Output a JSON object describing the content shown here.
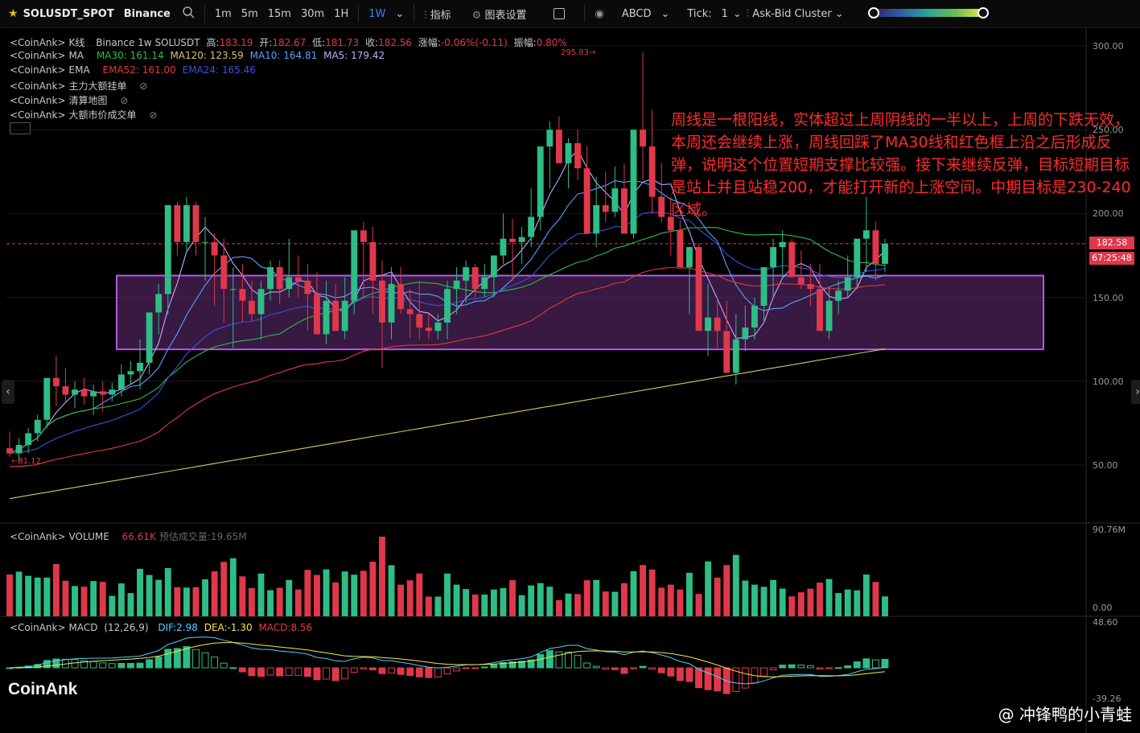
{
  "toolbar": {
    "symbol": "SOLUSDT_SPOT",
    "exchange": "Binance",
    "intervals": [
      "1m",
      "5m",
      "15m",
      "30m",
      "1H",
      "1W"
    ],
    "active_interval": "1W",
    "indicators_label": "指标",
    "chart_settings_label": "图表设置",
    "abcd_label": "ABCD",
    "tick_label": "Tick:",
    "tick_value": "1",
    "cluster_label": "Ask-Bid Cluster"
  },
  "legends": {
    "kline": {
      "source": "<CoinAnk>",
      "name": "K线",
      "info": "Binance 1w SOLUSDT",
      "high_label": "高:",
      "high": "183.19",
      "open_label": "开:",
      "open": "182.67",
      "low_label": "低:",
      "low": "181.73",
      "close_label": "收:",
      "close": "182.56",
      "change_label": "涨幅:",
      "change": "-0.06%(-0.11)",
      "amp_label": "振幅:",
      "amp": "0.80%"
    },
    "ma": {
      "source": "<CoinAnk>",
      "name": "MA",
      "ma30": "MA30: 161.14",
      "ma120": "MA120: 123.59",
      "ma10": "MA10: 164.81",
      "ma5": "MA5: 179.42"
    },
    "ema": {
      "source": "<CoinAnk>",
      "name": "EMA",
      "ema52": "EMA52: 161.00",
      "ema24": "EMA24: 165.46"
    },
    "big_orders": {
      "source": "<CoinAnk>",
      "name": "主力大额挂单"
    },
    "liq_map": {
      "source": "<CoinAnk>",
      "name": "清算地图"
    },
    "big_trades": {
      "source": "<CoinAnk>",
      "name": "大额市价成交单"
    },
    "volume": {
      "source": "<CoinAnk>",
      "name": "VOLUME",
      "vol": "66.61K",
      "est_label": "预估成交量:",
      "est": "19.65M"
    },
    "macd": {
      "source": "<CoinAnk>",
      "name": "MACD",
      "params": "(12,26,9)",
      "dif": "DIF:2.98",
      "dea": "DEA:-1.30",
      "macd": "MACD:8.56"
    }
  },
  "annotation": {
    "text": "周线是一根阳线，实体超过上周阴线的一半以上，上周的下跌无效，本周还会继续上涨，周线回踩了MA30线和红色框上沿之后形成反弹，说明这个位置短期支撑比较强。接下来继续反弹，目标短期目标是站上并且站稳200，才能打开新的上涨空间。中期目标是230-240区域。"
  },
  "price_axis": {
    "labels": [
      "300.00",
      "250.00",
      "200.00",
      "150.00",
      "100.00",
      "50.00"
    ],
    "current_price": "182.58",
    "countdown": "67:25:48",
    "high_marker": "295.83",
    "low_marker": "81.12"
  },
  "volume_axis": {
    "top": "90.76M",
    "bottom": "0.00"
  },
  "macd_axis": {
    "top": "48.60",
    "bottom": "-39.26"
  },
  "branding": {
    "logo": "CoinAnk",
    "watermark": "@ 冲锋鸭的小青蛙"
  },
  "colors": {
    "up": "#2ebd85",
    "down": "#e0384b",
    "box_fill": "#5b2a6e",
    "box_border": "#b45ae0",
    "annotation": "#ff2a2a",
    "ma5": "#c6a7ff",
    "ma10": "#5aa0ff",
    "ma30": "#2ebd4a",
    "ma120": "#d8c46a",
    "ema52": "#e03b3b",
    "ema24": "#3a52e0"
  },
  "chart_data": {
    "type": "candlestick",
    "title": "SOLUSDT 1w",
    "ylim": [
      0,
      310
    ],
    "y_ticks": [
      50,
      100,
      150,
      200,
      250,
      300
    ],
    "support_box": {
      "low": 119,
      "high": 163
    },
    "candles": [
      [
        60,
        70,
        55,
        57
      ],
      [
        57,
        66,
        51,
        62
      ],
      [
        62,
        72,
        57,
        69
      ],
      [
        69,
        80,
        64,
        77
      ],
      [
        77,
        90,
        72,
        102
      ],
      [
        102,
        115,
        85,
        97
      ],
      [
        97,
        108,
        88,
        92
      ],
      [
        92,
        100,
        84,
        95
      ],
      [
        95,
        102,
        86,
        91
      ],
      [
        91,
        98,
        80,
        94
      ],
      [
        94,
        100,
        82,
        92
      ],
      [
        92,
        99,
        88,
        95
      ],
      [
        95,
        110,
        91,
        104
      ],
      [
        104,
        112,
        98,
        106
      ],
      [
        106,
        125,
        95,
        111
      ],
      [
        111,
        132,
        104,
        141
      ],
      [
        141,
        158,
        128,
        152
      ],
      [
        152,
        185,
        140,
        205
      ],
      [
        205,
        207,
        175,
        183
      ],
      [
        183,
        210,
        178,
        205
      ],
      [
        205,
        207,
        175,
        183
      ],
      [
        183,
        198,
        160,
        183
      ],
      [
        183,
        188,
        145,
        175
      ],
      [
        175,
        185,
        135,
        155
      ],
      [
        155,
        168,
        120,
        155
      ],
      [
        155,
        170,
        135,
        148
      ],
      [
        148,
        160,
        136,
        140
      ],
      [
        140,
        160,
        125,
        155
      ],
      [
        155,
        172,
        148,
        168
      ],
      [
        168,
        172,
        146,
        155
      ],
      [
        155,
        185,
        150,
        162
      ],
      [
        162,
        175,
        150,
        160
      ],
      [
        160,
        170,
        130,
        152
      ],
      [
        152,
        165,
        130,
        128
      ],
      [
        128,
        160,
        122,
        148
      ],
      [
        148,
        158,
        130,
        130
      ],
      [
        130,
        162,
        125,
        148
      ],
      [
        148,
        178,
        140,
        190
      ],
      [
        190,
        195,
        150,
        183
      ],
      [
        183,
        192,
        140,
        160
      ],
      [
        160,
        172,
        108,
        135
      ],
      [
        135,
        168,
        125,
        158
      ],
      [
        158,
        168,
        140,
        143
      ],
      [
        143,
        155,
        126,
        140
      ],
      [
        140,
        160,
        125,
        132
      ],
      [
        132,
        140,
        125,
        130
      ],
      [
        130,
        140,
        125,
        135
      ],
      [
        135,
        160,
        125,
        155
      ],
      [
        155,
        168,
        140,
        160
      ],
      [
        160,
        172,
        147,
        168
      ],
      [
        168,
        170,
        150,
        155
      ],
      [
        155,
        170,
        150,
        162
      ],
      [
        162,
        175,
        150,
        175
      ],
      [
        175,
        200,
        170,
        185
      ],
      [
        185,
        197,
        160,
        183
      ],
      [
        183,
        192,
        170,
        186
      ],
      [
        186,
        215,
        180,
        198
      ],
      [
        198,
        230,
        190,
        240
      ],
      [
        240,
        255,
        215,
        250
      ],
      [
        250,
        258,
        235,
        230
      ],
      [
        230,
        245,
        215,
        242
      ],
      [
        242,
        250,
        220,
        227
      ],
      [
        227,
        240,
        195,
        188
      ],
      [
        188,
        222,
        180,
        205
      ],
      [
        205,
        225,
        195,
        201
      ],
      [
        201,
        228,
        198,
        215
      ],
      [
        215,
        230,
        190,
        188
      ],
      [
        188,
        240,
        185,
        250
      ],
      [
        250,
        296,
        220,
        240
      ],
      [
        240,
        262,
        200,
        210
      ],
      [
        210,
        230,
        195,
        198
      ],
      [
        198,
        210,
        175,
        190
      ],
      [
        190,
        196,
        168,
        168
      ],
      [
        168,
        180,
        140,
        180
      ],
      [
        180,
        182,
        160,
        130
      ],
      [
        130,
        158,
        115,
        138
      ],
      [
        138,
        150,
        120,
        130
      ],
      [
        130,
        148,
        110,
        105
      ],
      [
        105,
        140,
        98,
        125
      ],
      [
        125,
        145,
        118,
        132
      ],
      [
        132,
        150,
        125,
        145
      ],
      [
        145,
        160,
        135,
        168
      ],
      [
        168,
        185,
        150,
        180
      ],
      [
        180,
        190,
        162,
        183
      ],
      [
        183,
        185,
        165,
        162
      ],
      [
        162,
        178,
        155,
        158
      ],
      [
        158,
        170,
        145,
        155
      ],
      [
        155,
        170,
        140,
        130
      ],
      [
        130,
        155,
        125,
        148
      ],
      [
        148,
        160,
        140,
        154
      ],
      [
        154,
        175,
        150,
        162
      ],
      [
        162,
        180,
        155,
        185
      ],
      [
        185,
        210,
        165,
        190
      ],
      [
        190,
        195,
        160,
        170
      ],
      [
        170,
        185,
        165,
        182
      ]
    ]
  }
}
